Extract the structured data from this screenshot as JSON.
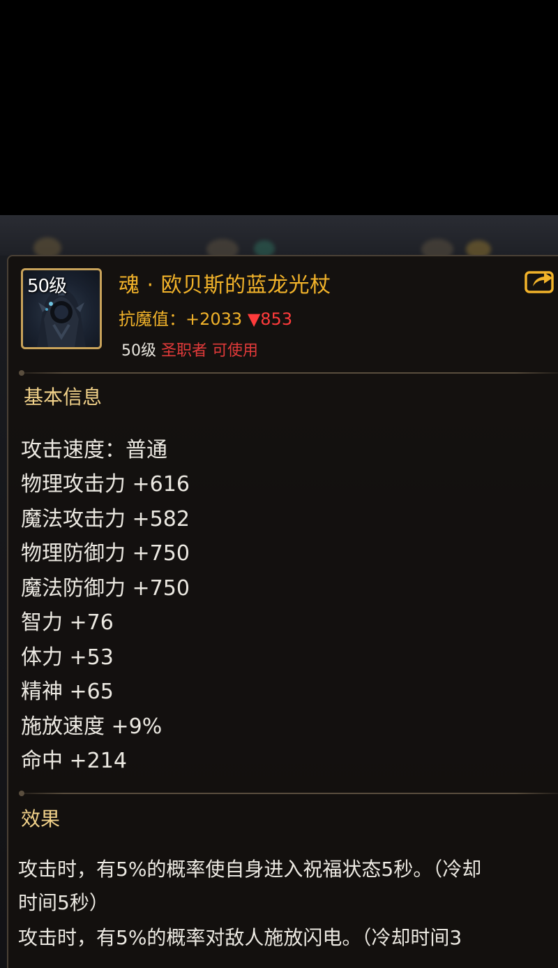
{
  "item": {
    "level_badge": "50级",
    "name": "魂 · 欧贝斯的蓝龙光杖",
    "resist_label": "抗魔值：",
    "resist_value": "+2033",
    "resist_diff": "▼853",
    "req_level": "50级",
    "req_class": "圣职者 可使用"
  },
  "basic_info": {
    "title": "基本信息",
    "stats": [
      "攻击速度：普通",
      "物理攻击力 +616",
      "魔法攻击力 +582",
      "物理防御力 +750",
      "魔法防御力 +750",
      "智力 +76",
      "体力 +53",
      "精神 +65",
      "施放速度 +9%",
      "命中 +214"
    ]
  },
  "effect": {
    "title": "效果",
    "lines": [
      "攻击时，有5%的概率使自身进入祝福状态5秒。（冷却",
      "时间5秒）",
      "攻击时，有5%的概率对敌人施放闪电。（冷却时间3"
    ]
  },
  "colors": {
    "item_name": "#f2b32a",
    "stat_text": "#ece9e2",
    "section_title": "#f2d28a",
    "diff_red": "#ff3b3b",
    "frame_gold": "#c9a35a"
  },
  "icons": {
    "share": "share-arrow-icon",
    "item": "dragon-staff-icon"
  }
}
